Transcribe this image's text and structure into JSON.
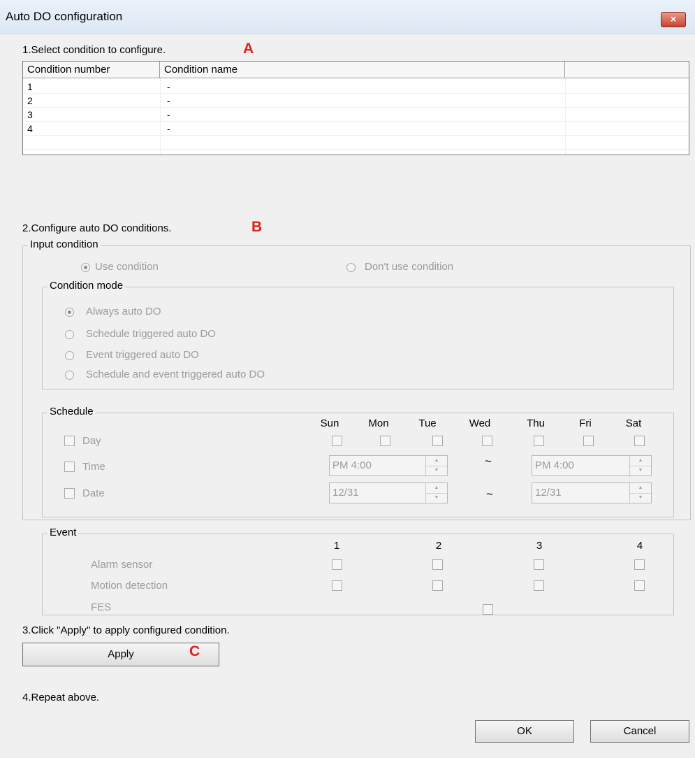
{
  "window": {
    "title": "Auto DO configuration",
    "close_glyph": "×"
  },
  "step1": {
    "label": "1.Select condition to configure.",
    "marker": "A"
  },
  "list": {
    "columns": [
      "Condition number",
      "Condition name",
      ""
    ],
    "rows": [
      {
        "number": "1",
        "name": "-"
      },
      {
        "number": "2",
        "name": "-"
      },
      {
        "number": "3",
        "name": "-"
      },
      {
        "number": "4",
        "name": "-"
      }
    ]
  },
  "step2": {
    "label": "2.Configure auto DO conditions.",
    "marker": "B"
  },
  "input_condition": {
    "legend": "Input condition",
    "use_label": "Use condition",
    "dont_use_label": "Don't use condition",
    "selected": "use"
  },
  "condition_mode": {
    "legend": "Condition mode",
    "options": [
      "Always auto DO",
      "Schedule triggered auto DO",
      "Event triggered auto DO",
      "Schedule and event triggered auto DO"
    ],
    "selected_index": 0
  },
  "schedule": {
    "legend": "Schedule",
    "days": [
      "Sun",
      "Mon",
      "Tue",
      "Wed",
      "Thu",
      "Fri",
      "Sat"
    ],
    "day_label": "Day",
    "time_label": "Time",
    "date_label": "Date",
    "time_from": "PM  4:00",
    "time_to": "PM  4:00",
    "date_from": "12/31",
    "date_to": "12/31",
    "range_separator": "~"
  },
  "event": {
    "legend": "Event",
    "channels": [
      "1",
      "2",
      "3",
      "4"
    ],
    "alarm_label": "Alarm sensor",
    "motion_label": "Motion detection",
    "fes_label": "FES"
  },
  "step3": {
    "label": "3.Click \"Apply\" to apply configured condition.",
    "marker": "C",
    "apply_label": "Apply"
  },
  "step4": {
    "label": "4.Repeat above."
  },
  "footer": {
    "ok_label": "OK",
    "cancel_label": "Cancel"
  },
  "colors": {
    "marker": "#e0201c",
    "disabled_text": "#9b9b9b",
    "dialog_bg": "#f0f0f0"
  }
}
